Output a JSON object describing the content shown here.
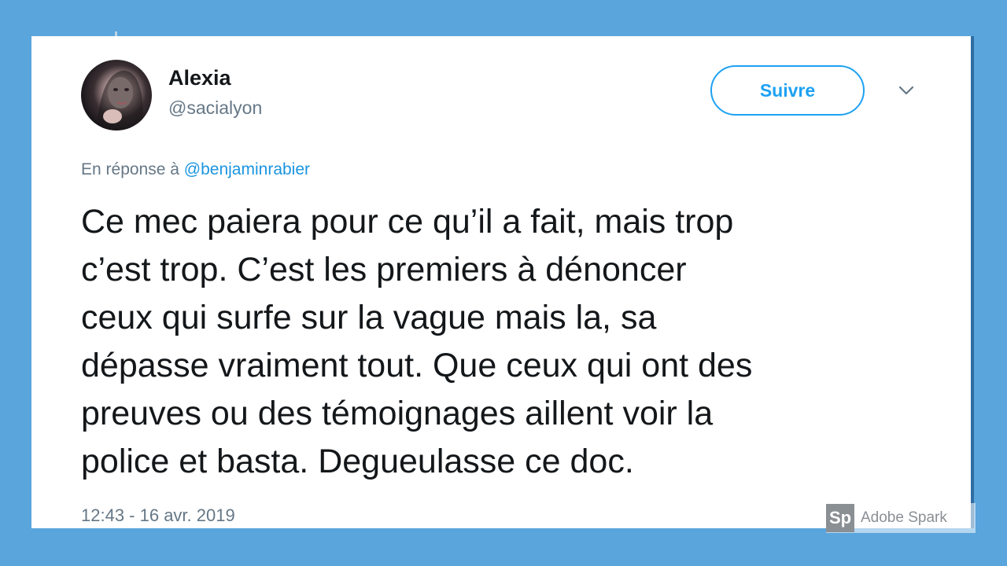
{
  "tweet": {
    "author_name": "Alexia",
    "author_handle": "@sacialyon",
    "follow_label": "Suivre",
    "reply_prefix": "En réponse à",
    "reply_mention": "@benjaminrabier",
    "text_lines": [
      "Ce mec paiera pour ce qu’il a fait, mais trop",
      "c’est trop. C’est les premiers à dénoncer",
      "ceux qui surfe sur la vague mais la, sa",
      "dépasse vraiment tout. Que ceux qui ont des",
      "preuves ou des témoignages aillent voir la",
      "police et basta. Degueulasse ce doc."
    ],
    "timestamp": "12:43 - 16 avr. 2019"
  },
  "watermark": {
    "logo": "Sp",
    "text": "Adobe Spark"
  },
  "colors": {
    "background": "#5aa5dc",
    "accent": "#1da1f2",
    "text": "#14171a",
    "muted": "#657786"
  },
  "icons": {
    "menu": "chevron-down-icon",
    "avatar": "avatar"
  }
}
